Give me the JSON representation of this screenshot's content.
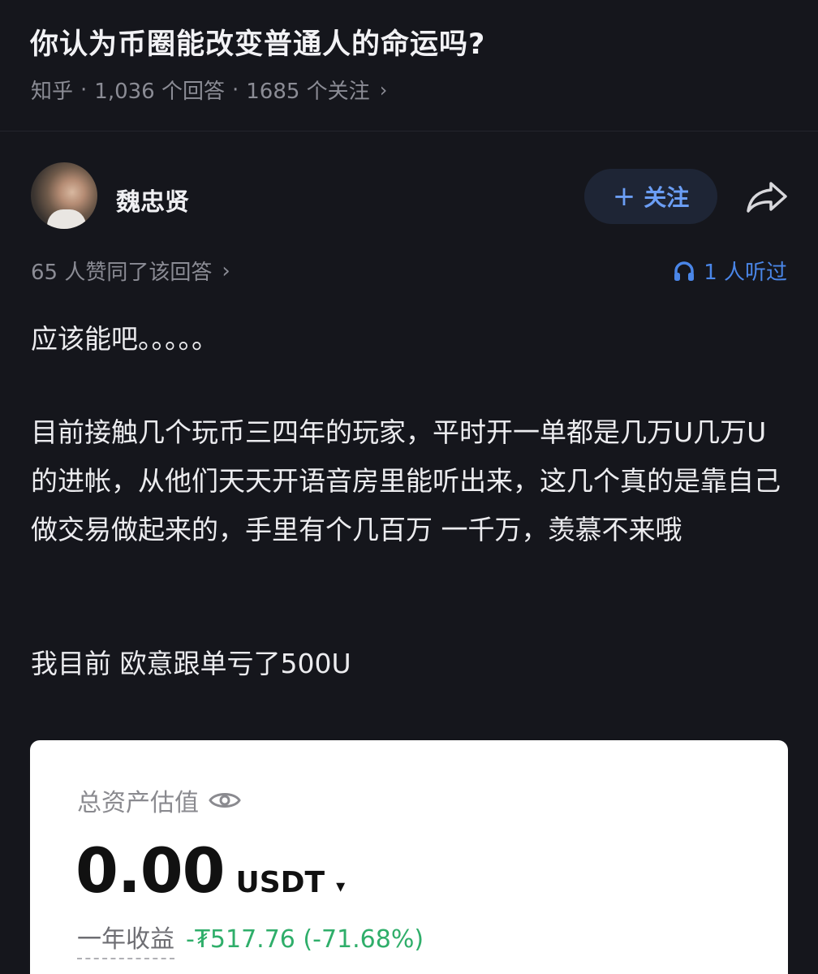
{
  "question": {
    "title": "你认为币圈能改变普通人的命运吗?",
    "source": "知乎",
    "answers_count": "1,036 个回答",
    "followers_count": "1685 个关注",
    "separator": "·",
    "chevron": "›"
  },
  "author": {
    "name": "魏忠贤",
    "follow_label": "关注",
    "follow_plus": "+"
  },
  "stats": {
    "votes": "65 人赞同了该回答",
    "chevron": "›",
    "listened": "1 人听过"
  },
  "answer": {
    "p1": "应该能吧。。。。。",
    "p2": "目前接触几个玩币三四年的玩家，平时开一单都是几万U几万U的进帐，从他们天天开语音房里能听出来，这几个真的是靠自己做交易做起来的，手里有个几百万 一千万，羡慕不来哦",
    "p3": "我目前 欧意跟单亏了500U"
  },
  "embedded_card": {
    "label": "总资产估值",
    "balance": "0.00",
    "unit": "USDT",
    "caret": "▾",
    "yield_label": "一年收益",
    "yield_value": "-₮517.76 (-71.68%)"
  },
  "colors": {
    "background": "#15161c",
    "accent_blue": "#4a86e8",
    "follow_bg": "#1e2535",
    "gain_green": "#2fae6a"
  },
  "icons": [
    "share-icon",
    "headphone-icon",
    "eye-icon",
    "chevron-right-icon",
    "plus-icon",
    "caret-down-icon"
  ]
}
